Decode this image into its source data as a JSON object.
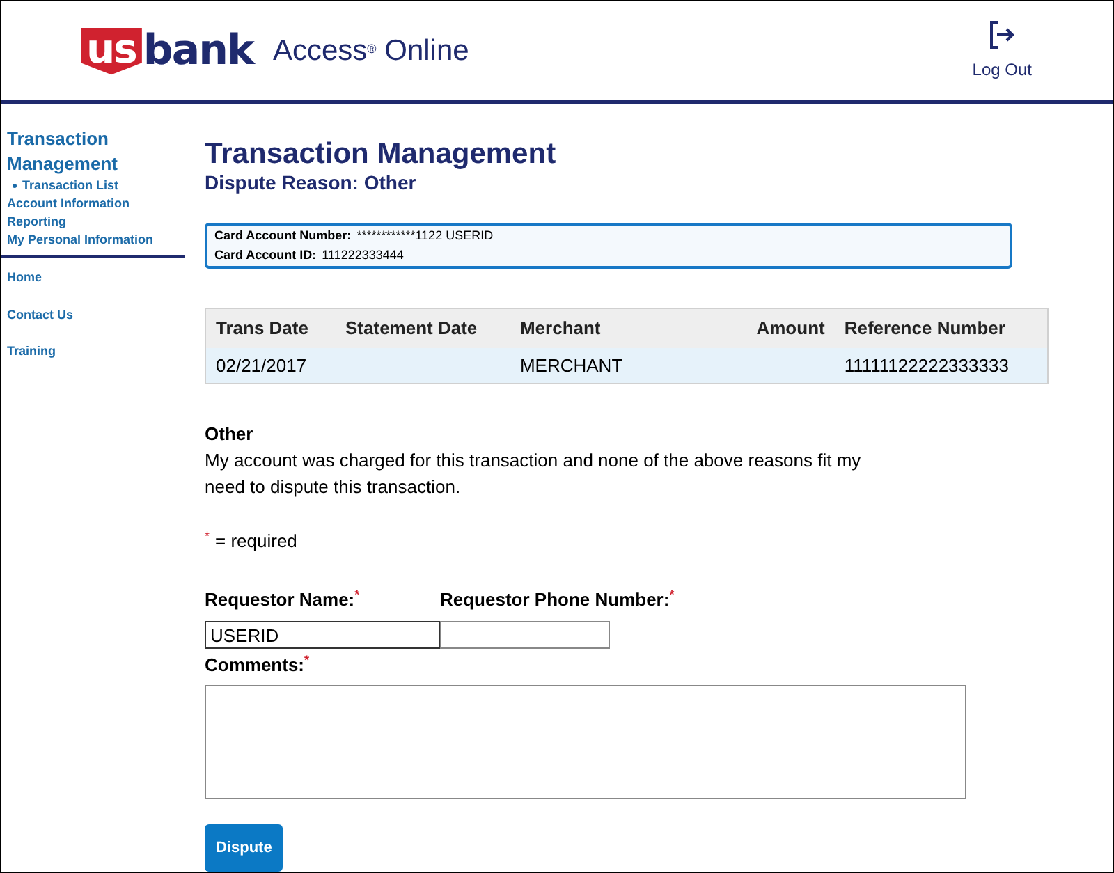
{
  "header": {
    "logo_shield": "us",
    "logo_word": "bank",
    "product": "Access$^{®}$ Online",
    "logout": "Log Out"
  },
  "sidebar": {
    "items": [
      {
        "label": "Transaction Management",
        "kind": "section",
        "children": [
          {
            "label": "Transaction List"
          }
        ]
      },
      {
        "label": "Account Information",
        "kind": "link"
      },
      {
        "label": "Reporting",
        "kind": "link"
      },
      {
        "label": "My Personal Information",
        "kind": "link"
      }
    ],
    "bottom_items": [
      "Home",
      "Contact Us",
      "Training"
    ]
  },
  "page": {
    "title": "Transaction Management",
    "subtitle": "Dispute Reason: Other"
  },
  "account": [
    {
      "label": "Card Account Number:",
      "value": "************1122 USERID"
    },
    {
      "label": "Card Account ID:",
      "value": "111222333444"
    }
  ],
  "table": {
    "columns": [
      "Trans Date",
      "Statement Date",
      "Merchant",
      "Amount",
      "Reference Number"
    ],
    "rows": [
      [
        "02/21/2017",
        "",
        "MERCHANT",
        "",
        "11111122222333333"
      ]
    ]
  },
  "reason": {
    "title": "Other",
    "text": "My account was charged for this transaction and none of the above reasons fit my need to dispute this transaction."
  },
  "required_note": {
    "mark": "*",
    "text": "= required"
  },
  "form": {
    "fields": [
      {
        "label": "Requestor Name:",
        "mark": "*",
        "value": "USERID",
        "kind": "name"
      },
      {
        "label": "Requestor Phone Number:",
        "mark": "*",
        "kind": "phone"
      },
      {
        "label": "Comments:",
        "mark": "*",
        "kind": "textarea"
      }
    ],
    "button": "Dispute"
  }
}
